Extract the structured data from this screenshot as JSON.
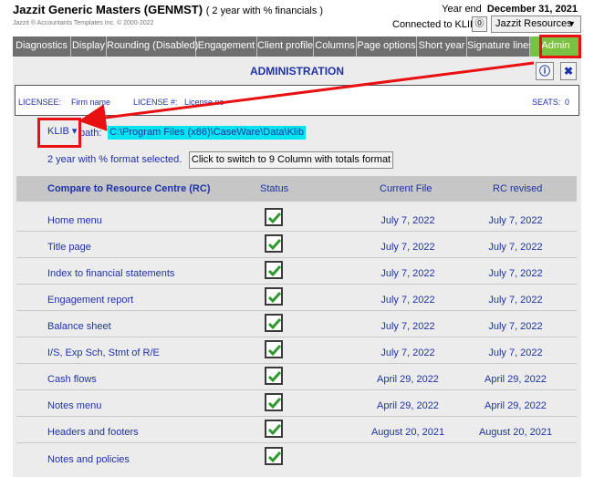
{
  "header": {
    "title": "Jazzit Generic Masters (GENMST)",
    "subtitle": "( 2 year with % financials )",
    "copyright": "Jazzit ® Accountants Templates Inc. © 2000-2022",
    "year_end_label": "Year end",
    "year_end_date": "December 31, 2021",
    "connected_text": "Connected to KLIB",
    "connect_icon": "⓪",
    "resources_label": "Jazzit Resources",
    "resources_arrow": "▼"
  },
  "tabs": [
    {
      "label": "Diagnostics"
    },
    {
      "label": "Display"
    },
    {
      "label": "Rounding (Disabled)"
    },
    {
      "label": "Engagement"
    },
    {
      "label": "Client profile"
    },
    {
      "label": "Columns"
    },
    {
      "label": "Page options"
    },
    {
      "label": "Short year"
    },
    {
      "label": "Signature lines"
    },
    {
      "label": "Admin"
    }
  ],
  "admin": {
    "title": "ADMINISTRATION",
    "info_label": "ⓘ",
    "close_label": "✖",
    "licensee_label": "LICENSEE:",
    "licensee_value": "Firm name",
    "license_label": "LICENSE #:",
    "license_value": "License no",
    "seats_label": "SEATS:",
    "seats_value": "0",
    "klib_selected": "KLIB",
    "klib_arrow": "▾",
    "path_label": "path:",
    "path_value": "C:\\Program Files (x86)\\CaseWare\\Data\\Klib",
    "format_text": "2 year with % format selected.",
    "switch_button": "Click to switch to 9 Column with totals format"
  },
  "table": {
    "headers": {
      "name": "Compare to Resource Centre (RC)",
      "status": "Status",
      "current": "Current File",
      "rc": "RC revised"
    },
    "rows": [
      {
        "name": "Home menu",
        "current": "July 7, 2022",
        "rc": "July 7, 2022"
      },
      {
        "name": "Title page",
        "current": "July 7, 2022",
        "rc": "July 7, 2022"
      },
      {
        "name": "Index to financial statements",
        "current": "July 7, 2022",
        "rc": "July 7, 2022"
      },
      {
        "name": "Engagement report",
        "current": "July 7, 2022",
        "rc": "July 7, 2022"
      },
      {
        "name": "Balance sheet",
        "current": "July 7, 2022",
        "rc": "July 7, 2022"
      },
      {
        "name": "I/S, Exp Sch, Stmt of R/E",
        "current": "July 7, 2022",
        "rc": "July 7, 2022"
      },
      {
        "name": "Cash flows",
        "current": "April 29, 2022",
        "rc": "April 29, 2022"
      },
      {
        "name": "Notes menu",
        "current": "April 29, 2022",
        "rc": "April 29, 2022"
      },
      {
        "name": "Headers and footers",
        "current": "August 20, 2021",
        "rc": "August 20, 2021"
      },
      {
        "name": "Notes and policies",
        "current": "",
        "rc": ""
      }
    ]
  },
  "colors": {
    "tab_bg": "#6f6f6f",
    "tab_active": "#7ac143",
    "text_blue": "#1f32a8",
    "path_highlight": "#00e5ee",
    "annotation_red": "#e81010",
    "check_green": "#2e9a2e"
  },
  "icons": [
    "info-icon",
    "close-icon",
    "checkmark-icon",
    "chevron-down-icon"
  ]
}
